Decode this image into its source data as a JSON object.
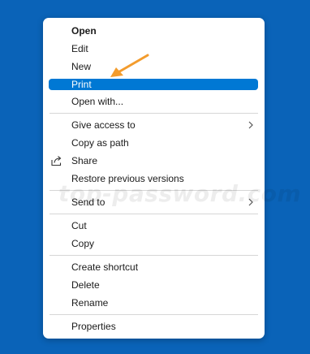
{
  "context_menu": {
    "items": [
      {
        "label": "Open"
      },
      {
        "label": "Edit"
      },
      {
        "label": "New"
      },
      {
        "label": "Print"
      },
      {
        "label": "Open with..."
      },
      {
        "label": "Give access to"
      },
      {
        "label": "Copy as path"
      },
      {
        "label": "Share"
      },
      {
        "label": "Restore previous versions"
      },
      {
        "label": "Send to"
      },
      {
        "label": "Cut"
      },
      {
        "label": "Copy"
      },
      {
        "label": "Create shortcut"
      },
      {
        "label": "Delete"
      },
      {
        "label": "Rename"
      },
      {
        "label": "Properties"
      }
    ],
    "highlighted_item": "Print",
    "icons": {
      "share": "share-icon",
      "submenu": "chevron-right-icon"
    }
  },
  "annotation": {
    "arrow_color": "#f39c2d",
    "target": "Print"
  },
  "watermark": "top-password.com",
  "colors": {
    "desktop_background": "#0a63b8",
    "highlight": "#0078d4",
    "menu_background": "#ffffff"
  }
}
